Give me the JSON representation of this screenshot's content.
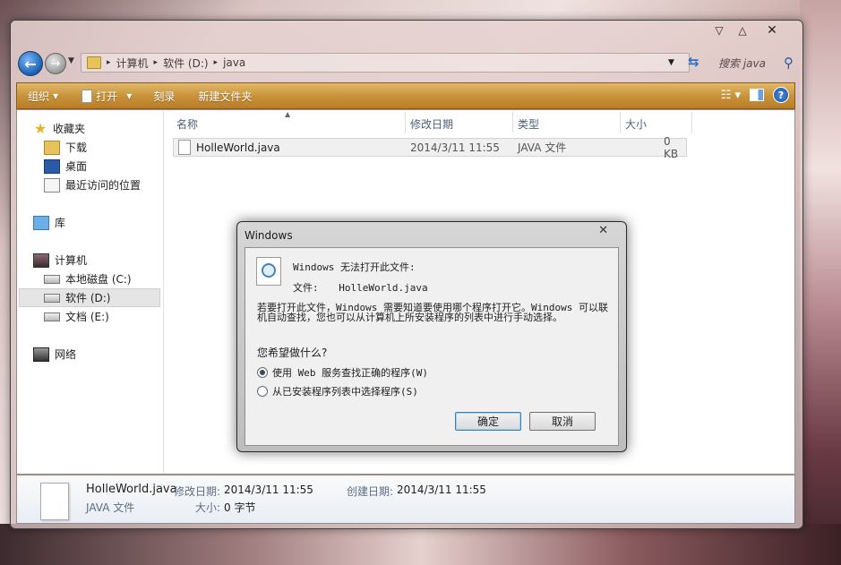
{
  "window": {
    "caption_buttons": [
      "▽",
      "△",
      "✕"
    ]
  },
  "address": {
    "crumbs": [
      "计算机",
      "软件 (D:)",
      "java"
    ],
    "search_placeholder": "搜索 java"
  },
  "toolbar": {
    "organize": "组织",
    "open": "打开",
    "burn": "刻录",
    "new_folder": "新建文件夹"
  },
  "sidebar": {
    "favorites": "收藏夹",
    "downloads": "下载",
    "desktop": "桌面",
    "recent": "最近访问的位置",
    "libraries": "库",
    "computer": "计算机",
    "drive_c": "本地磁盘 (C:)",
    "drive_d": "软件 (D:)",
    "drive_e": "文档 (E:)",
    "network": "网络"
  },
  "columns": {
    "name": "名称",
    "modified": "修改日期",
    "type": "类型",
    "size": "大小"
  },
  "files": [
    {
      "name": "HolleWorld.java",
      "modified": "2014/3/11 11:55",
      "type": "JAVA 文件",
      "size": "0 KB"
    }
  ],
  "details": {
    "name": "HolleWorld.java",
    "type": "JAVA 文件",
    "modified_label": "修改日期:",
    "modified_value": "2014/3/11 11:55",
    "created_label": "创建日期:",
    "created_value": "2014/3/11 11:55",
    "size_label": "大小:",
    "size_value": "0 字节"
  },
  "dialog": {
    "title": "Windows",
    "close": "✕",
    "line1": "Windows 无法打开此文件:",
    "file_label": "文件:",
    "file_name": "HolleWorld.java",
    "paragraph": "若要打开此文件，Windows 需要知道要使用哪个程序打开它。Windows 可以联机自动查找，您也可以从计算机上所安装程序的列表中进行手动选择。",
    "question": "您希望做什么?",
    "option_web": "使用 Web 服务查找正确的程序(W)",
    "option_list": "从已安装程序列表中选择程序(S)",
    "ok": "确定",
    "cancel": "取消",
    "selected_option": "web"
  }
}
